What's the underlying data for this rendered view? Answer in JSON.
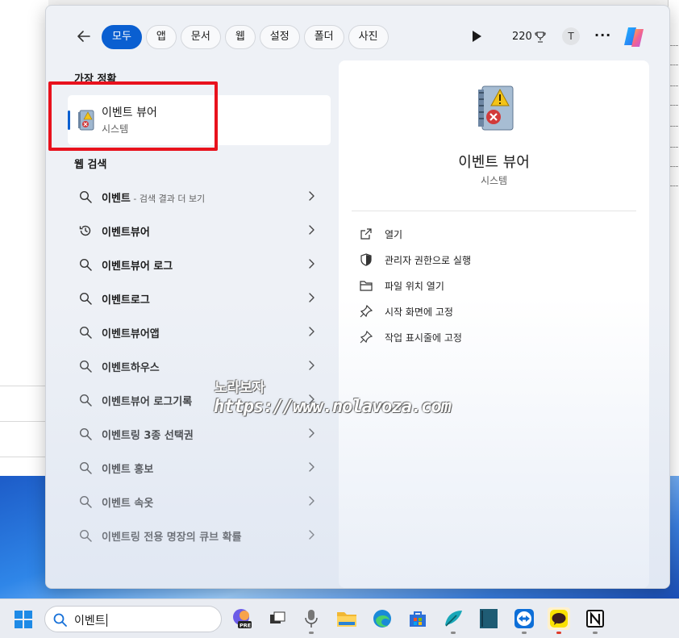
{
  "header": {
    "tabs": [
      {
        "label": "모두",
        "active": true
      },
      {
        "label": "앱",
        "active": false
      },
      {
        "label": "문서",
        "active": false
      },
      {
        "label": "웹",
        "active": false
      },
      {
        "label": "설정",
        "active": false
      },
      {
        "label": "폴더",
        "active": false
      },
      {
        "label": "사진",
        "active": false
      }
    ],
    "points": "220",
    "avatar_initial": "T",
    "more_label": "···"
  },
  "best_match": {
    "section_label": "가장 정확",
    "title": "이벤트 뷰어",
    "subtitle": "시스템"
  },
  "web_search": {
    "section_label": "웹 검색",
    "results": [
      {
        "text": "이벤트",
        "suffix": " - 검색 결과 더 보기",
        "icon": "search-icon"
      },
      {
        "text": "이벤트뷰어",
        "suffix": "",
        "icon": "history-icon"
      },
      {
        "text": "이벤트뷰어 로그",
        "suffix": "",
        "icon": "search-icon"
      },
      {
        "text": "이벤트로그",
        "suffix": "",
        "icon": "search-icon"
      },
      {
        "text": "이벤트뷰어앱",
        "suffix": "",
        "icon": "search-icon"
      },
      {
        "text": "이벤트하우스",
        "suffix": "",
        "icon": "search-icon"
      },
      {
        "text": "이벤트뷰어 로그기록",
        "suffix": "",
        "icon": "search-icon"
      },
      {
        "text": "이벤트링 3종 선택권",
        "suffix": "",
        "icon": "search-icon"
      },
      {
        "text": "이벤트 홍보",
        "suffix": "",
        "icon": "search-icon"
      },
      {
        "text": "이벤트 속옷",
        "suffix": "",
        "icon": "search-icon"
      },
      {
        "text": "이벤트링 전용 명장의 큐브 확률",
        "suffix": "",
        "icon": "search-icon"
      }
    ]
  },
  "preview": {
    "title": "이벤트 뷰어",
    "subtitle": "시스템",
    "actions": [
      {
        "label": "열기",
        "icon": "open-external-icon"
      },
      {
        "label": "관리자 권한으로 실행",
        "icon": "shield-icon"
      },
      {
        "label": "파일 위치 열기",
        "icon": "folder-icon"
      },
      {
        "label": "시작 화면에 고정",
        "icon": "pin-icon"
      },
      {
        "label": "작업 표시줄에 고정",
        "icon": "pin-icon"
      }
    ]
  },
  "watermark": {
    "line1": "노라보자",
    "line2": "https://www.nolavoza.com"
  },
  "taskbar": {
    "search_value": "이벤트"
  },
  "colors": {
    "accent": "#0a5fd1",
    "highlight_box": "#e8121d"
  }
}
